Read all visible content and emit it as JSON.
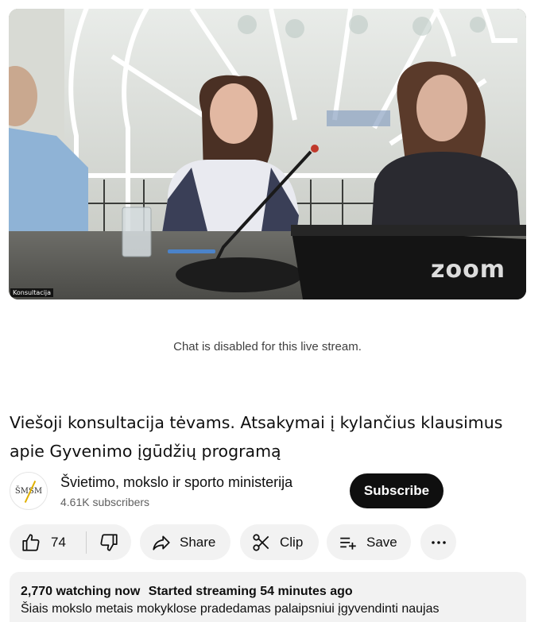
{
  "video": {
    "overlay_label": "Konsultacija",
    "watermark": "zoom"
  },
  "chat": {
    "disabled_text": "Chat is disabled for this live stream."
  },
  "title": "Viešoji konsultacija tėvams. Atsakymai į kylančius klausimus apie Gyvenimo įgūdžių programą",
  "channel": {
    "name": "Švietimo, mokslo ir sporto ministerija",
    "subscribers": "4.61K subscribers",
    "avatar_text": "ŠMSM",
    "subscribe_label": "Subscribe"
  },
  "actions": {
    "like_count": "74",
    "share_label": "Share",
    "clip_label": "Clip",
    "save_label": "Save",
    "like_icon": "thumb-up-icon",
    "dislike_icon": "thumb-down-icon",
    "share_icon": "share-arrow-icon",
    "clip_icon": "scissors-icon",
    "save_icon": "playlist-add-icon",
    "more_icon": "more-horizontal-icon"
  },
  "description": {
    "watching": "2,770 watching now",
    "started": "Started streaming 54 minutes ago",
    "text": "Šiais mokslo metais mokyklose pradedamas palaipsniui įgyvendinti naujas"
  }
}
